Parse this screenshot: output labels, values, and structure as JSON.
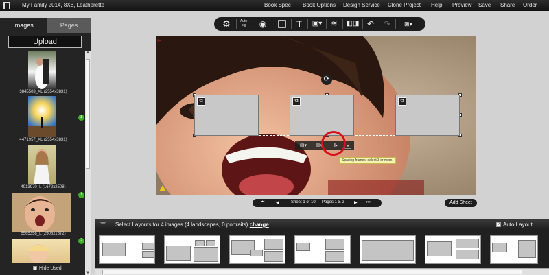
{
  "app": {
    "title": "My Family 2014, 8X8, Leatherette",
    "menu": [
      "Book Spec",
      "Book Options",
      "Design Service",
      "Clone Project",
      "Help",
      "Preview",
      "Save",
      "Share",
      "Order"
    ]
  },
  "left_panel": {
    "tabs": [
      "Images",
      "Pages"
    ],
    "upload_label": "Upload",
    "images": [
      {
        "label": "3845503_XL (2554x3831)",
        "badge": ""
      },
      {
        "label": "4471957_XL (2554x3831)",
        "badge": "1"
      },
      {
        "label": "4913970_L (1672x2508)",
        "badge": ""
      },
      {
        "label": "5565358_L (2508x1672)",
        "badge": "1"
      },
      {
        "label": "",
        "badge": "2"
      }
    ],
    "hide_used_label": "Hide Used"
  },
  "toolbar": {
    "auto_fill_label": "Auto\nFill",
    "icons": [
      "gear-icon",
      "auto-fill-icon",
      "eye-icon",
      "frame-icon",
      "text-icon",
      "add-image-icon",
      "layers-icon",
      "swap-icon",
      "undo-icon",
      "redo-icon",
      "delete-icon"
    ]
  },
  "canvas": {
    "tooltip": "Spacing frames, select 3 or more.",
    "accent": "#d6101a"
  },
  "pager": {
    "sheet_text": "Sheet 1 of 10",
    "pages_text": "Pages 1 & 2",
    "add_sheet_label": "Add Sheet"
  },
  "layouts": {
    "prompt": "Select Layouts for 4 images (4 landscapes, 0 portraits)",
    "change_label": "change",
    "auto_layout_label": "Auto Layout"
  }
}
